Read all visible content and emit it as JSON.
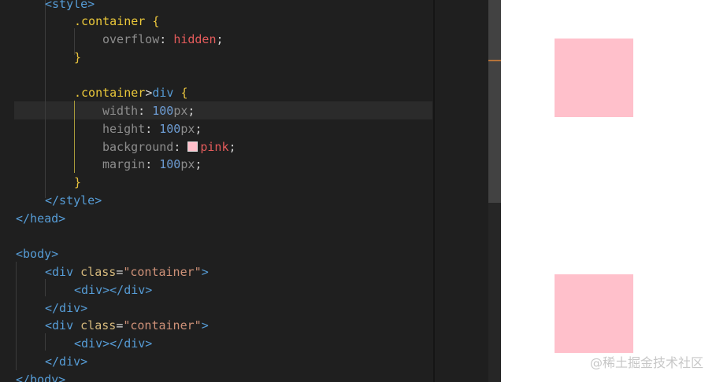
{
  "editor": {
    "lines": [
      {
        "id": "l0",
        "tokens": [
          {
            "t": "<style>",
            "c": "tag"
          }
        ]
      },
      {
        "id": "l1",
        "tokens": [
          {
            "t": ".container",
            "c": "sel"
          },
          {
            "t": " {",
            "c": "brace"
          }
        ]
      },
      {
        "id": "l2",
        "tokens": [
          {
            "t": "overflow",
            "c": "prop"
          },
          {
            "t": ": ",
            "c": "punct"
          },
          {
            "t": "hidden",
            "c": "kw"
          },
          {
            "t": ";",
            "c": "punct"
          }
        ]
      },
      {
        "id": "l3",
        "tokens": [
          {
            "t": "}",
            "c": "brace"
          }
        ]
      },
      {
        "id": "l4",
        "tokens": []
      },
      {
        "id": "l5",
        "tokens": [
          {
            "t": ".container",
            "c": "sel"
          },
          {
            "t": ">",
            "c": "punct"
          },
          {
            "t": "div",
            "c": "tag"
          },
          {
            "t": " {",
            "c": "brace"
          }
        ]
      },
      {
        "id": "l6",
        "tokens": [
          {
            "t": "width",
            "c": "prop"
          },
          {
            "t": ": ",
            "c": "punct"
          },
          {
            "t": "100",
            "c": "num"
          },
          {
            "t": "px",
            "c": "prop"
          },
          {
            "t": ";",
            "c": "punct"
          }
        ]
      },
      {
        "id": "l7",
        "tokens": [
          {
            "t": "height",
            "c": "prop"
          },
          {
            "t": ": ",
            "c": "punct"
          },
          {
            "t": "100",
            "c": "num"
          },
          {
            "t": "px",
            "c": "prop"
          },
          {
            "t": ";",
            "c": "punct"
          }
        ]
      },
      {
        "id": "l8",
        "tokens": [
          {
            "t": "background",
            "c": "prop"
          },
          {
            "t": ": ",
            "c": "punct"
          },
          {
            "t": "",
            "c": "swatch"
          },
          {
            "t": "pink",
            "c": "kw"
          },
          {
            "t": ";",
            "c": "punct"
          }
        ]
      },
      {
        "id": "l9",
        "tokens": [
          {
            "t": "margin",
            "c": "prop"
          },
          {
            "t": ": ",
            "c": "punct"
          },
          {
            "t": "100",
            "c": "num"
          },
          {
            "t": "px",
            "c": "prop"
          },
          {
            "t": ";",
            "c": "punct"
          }
        ]
      },
      {
        "id": "l10",
        "tokens": [
          {
            "t": "}",
            "c": "brace"
          }
        ]
      },
      {
        "id": "l11",
        "tokens": [
          {
            "t": "</style>",
            "c": "tag"
          }
        ]
      },
      {
        "id": "l12",
        "tokens": [
          {
            "t": "</head>",
            "c": "tag"
          }
        ]
      },
      {
        "id": "l13",
        "tokens": []
      },
      {
        "id": "l14",
        "tokens": [
          {
            "t": "<body>",
            "c": "tag"
          }
        ]
      },
      {
        "id": "l15",
        "tokens": [
          {
            "t": "<div ",
            "c": "tag"
          },
          {
            "t": "class",
            "c": "attr"
          },
          {
            "t": "=",
            "c": "punct"
          },
          {
            "t": "\"container\"",
            "c": "val"
          },
          {
            "t": ">",
            "c": "tag"
          }
        ]
      },
      {
        "id": "l16",
        "tokens": [
          {
            "t": "<div></div>",
            "c": "tag"
          }
        ]
      },
      {
        "id": "l17",
        "tokens": [
          {
            "t": "</div>",
            "c": "tag"
          }
        ]
      },
      {
        "id": "l18",
        "tokens": [
          {
            "t": "<div ",
            "c": "tag"
          },
          {
            "t": "class",
            "c": "attr"
          },
          {
            "t": "=",
            "c": "punct"
          },
          {
            "t": "\"container\"",
            "c": "val"
          },
          {
            "t": ">",
            "c": "tag"
          }
        ]
      },
      {
        "id": "l19",
        "tokens": [
          {
            "t": "<div></div>",
            "c": "tag"
          }
        ]
      },
      {
        "id": "l20",
        "tokens": [
          {
            "t": "</div>",
            "c": "tag"
          }
        ]
      },
      {
        "id": "l21",
        "tokens": [
          {
            "t": "</body>",
            "c": "tag"
          }
        ]
      }
    ],
    "swatch_color": "#ffc0cb"
  },
  "preview": {
    "box_color": "#ffc0cb",
    "watermark": "@稀土掘金技术社区"
  }
}
